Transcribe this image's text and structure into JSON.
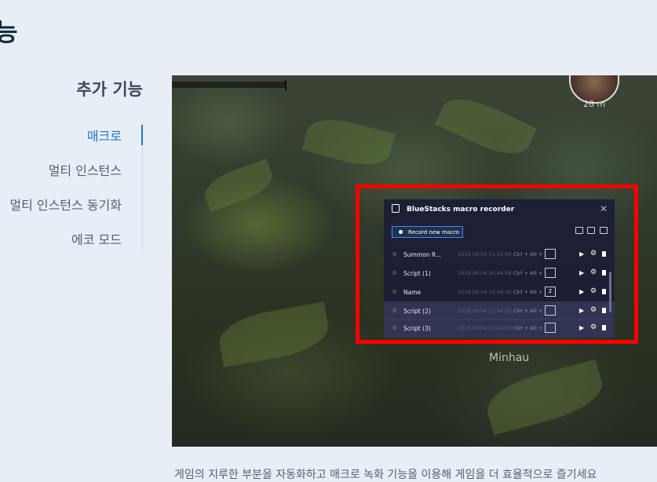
{
  "heading": "능",
  "sidebar": {
    "title": "추가 기능",
    "items": [
      {
        "label": "매크로",
        "active": true
      },
      {
        "label": "멀티 인스턴스",
        "active": false
      },
      {
        "label": "멀티 인스턴스 동기화",
        "active": false
      },
      {
        "label": "에코 모드",
        "active": false
      }
    ]
  },
  "screenshot": {
    "distance_label": "28 m",
    "player_name": "Minhau",
    "highlight_color": "#ff0000",
    "macro_recorder": {
      "title": "BlueStacks macro recorder",
      "close_icon": "close-icon",
      "record_button": "Record new macro",
      "toolbar_icons": [
        "import-icon",
        "export-icon",
        "folder-icon"
      ],
      "macros": [
        {
          "name": "Summon R...",
          "date": "2019.09.04 11:22:09",
          "shortcut": "Ctrl + Alt +",
          "key": ""
        },
        {
          "name": "Script (1)",
          "date": "2019.09.04 10:44:58",
          "shortcut": "Ctrl + Alt +",
          "key": ""
        },
        {
          "name": "Name",
          "date": "2019.09.04 10:58:30",
          "shortcut": "Ctrl + Alt +",
          "key": "2"
        },
        {
          "name": "Script (2)",
          "date": "2019.09.04 11:44:58",
          "shortcut": "Ctrl + Alt +",
          "key": ""
        },
        {
          "name": "Script (3)",
          "date": "2019.09.04 11:44:58",
          "shortcut": "Ctrl + Alt +",
          "key": ""
        }
      ]
    }
  },
  "caption": "게임의 지루한 부분을 자동화하고 매크로 녹화 기능을 이용해 게임을 더 효율적으로 즐기세요"
}
